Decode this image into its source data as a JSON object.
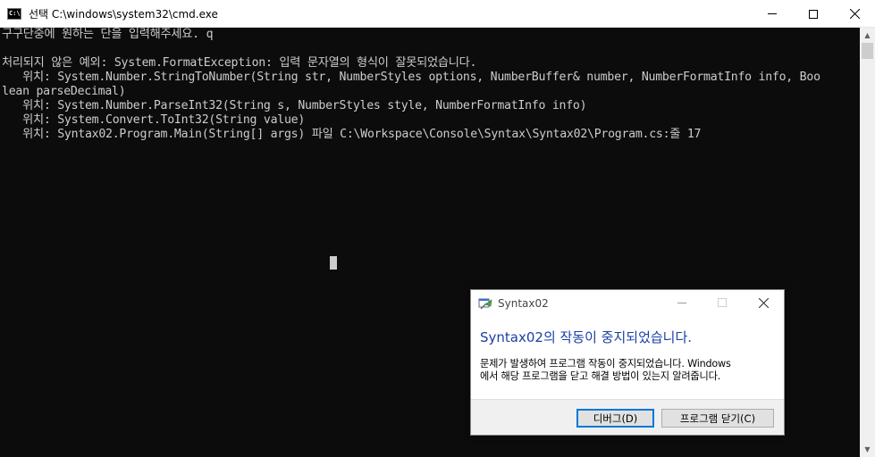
{
  "window": {
    "title": "선택 C:\\windows\\system32\\cmd.exe",
    "icon": "cmd-console-icon",
    "icon_text": "C:\\."
  },
  "console": {
    "lines": [
      "구구단중에 원하는 단을 입력해주세요. q",
      "",
      "처리되지 않은 예외: System.FormatException: 입력 문자열의 형식이 잘못되었습니다.",
      "   위치: System.Number.StringToNumber(String str, NumberStyles options, NumberBuffer& number, NumberFormatInfo info, Boo",
      "lean parseDecimal)",
      "   위치: System.Number.ParseInt32(String s, NumberStyles style, NumberFormatInfo info)",
      "   위치: System.Convert.ToInt32(String value)",
      "   위치: Syntax02.Program.Main(String[] args) 파일 C:\\Workspace\\Console\\Syntax\\Syntax02\\Program.cs:줄 17"
    ],
    "background": "#0c0c0c",
    "foreground": "#cccccc"
  },
  "dialog": {
    "title": "Syntax02",
    "heading": "Syntax02의 작동이 중지되었습니다.",
    "message_line1": "문제가 발생하여 프로그램 작동이 중지되었습니다. Windows",
    "message_line2": "에서 해당 프로그램을 닫고 해결 방법이 있는지 알려줍니다.",
    "debug_label": "디버그(D)",
    "close_label": "프로그램 닫기(C)",
    "heading_color": "#1a3fa6"
  }
}
